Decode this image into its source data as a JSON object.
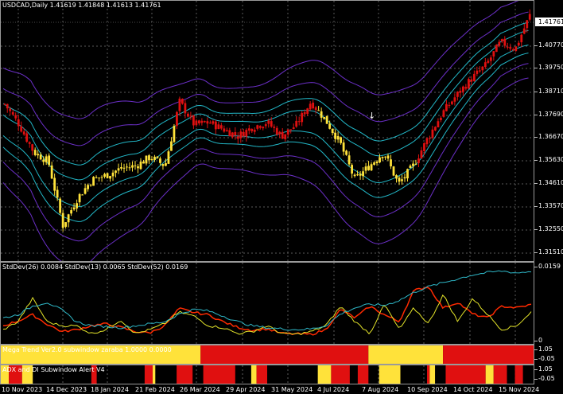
{
  "symbol_header": "USDCAD,Daily  1.41619 1.41848 1.41613 1.41761",
  "current_price": "1.41761",
  "price_axis": [
    "1.40770",
    "1.39750",
    "1.38710",
    "1.37690",
    "1.36670",
    "1.35630",
    "1.34610",
    "1.33570",
    "1.32550",
    "1.31510"
  ],
  "std_header": "StdDev(26) 0.0084  StdDev(13) 0.0065  StdDev(52) 0.0169",
  "std_axis": [
    "0.0159",
    "0"
  ],
  "mega_header": "Mega Trend Ver2.0 subwindow zaraba 1.0000 0.0000",
  "mega_axis": [
    "1.05",
    "-0.05"
  ],
  "adx_header": "ADX and DI Subwindow Alert V4",
  "adx_axis": [
    "1.05",
    "-0.05"
  ],
  "time_axis": [
    "10 Nov 2023",
    "14 Dec 2023",
    "18 Jan 2024",
    "21 Feb 2024",
    "26 Mar 2024",
    "29 Apr 2024",
    "31 May 2024",
    "4 Jul 2024",
    "7 Aug 2024",
    "10 Sep 2024",
    "14 Oct 2024",
    "15 Nov 2024"
  ],
  "colors": {
    "background": "#000000",
    "grid": "#5a5a5a",
    "bull_candle": "#ffe23a",
    "bear_candle": "#e01010",
    "band_inner": "#22b8c8",
    "band_outer": "#6b2fc8",
    "std26": "#ff2a00",
    "std13": "#e6e62a",
    "std52": "#2fb8c8",
    "mega_yellow": "#ffe23a",
    "mega_red": "#e01010"
  },
  "chart_data": [
    {
      "type": "candlestick",
      "title": "USDCAD,Daily",
      "ohlc_last": {
        "open": 1.41619,
        "high": 1.41848,
        "low": 1.41613,
        "close": 1.41761
      },
      "ylim": [
        1.3105,
        1.424
      ],
      "x": [
        "10 Nov 2023",
        "14 Dec 2023",
        "18 Jan 2024",
        "21 Feb 2024",
        "26 Mar 2024",
        "29 Apr 2024",
        "31 May 2024",
        "4 Jul 2024",
        "7 Aug 2024",
        "10 Sep 2024",
        "14 Oct 2024",
        "15 Nov 2024"
      ],
      "close_path": [
        1.379,
        1.37,
        1.358,
        1.354,
        1.326,
        1.338,
        1.346,
        1.348,
        1.351,
        1.352,
        1.356,
        1.352,
        1.38,
        1.37,
        1.371,
        1.368,
        1.365,
        1.369,
        1.371,
        1.365,
        1.37,
        1.38,
        1.372,
        1.362,
        1.346,
        1.352,
        1.358,
        1.344,
        1.352,
        1.364,
        1.375,
        1.383,
        1.39,
        1.396,
        1.406,
        1.403,
        1.4176
      ],
      "trend_state": [
        "bear",
        "bear",
        "bull",
        "bull",
        "bull",
        "bull",
        "bull",
        "bull",
        "bull",
        "bull",
        "bull",
        "bull",
        "bear",
        "bear",
        "bear",
        "bear",
        "bear",
        "bear",
        "bear",
        "bear",
        "bear",
        "bear",
        "bull",
        "bull",
        "bull",
        "bull",
        "bull",
        "bull",
        "bull",
        "bear",
        "bear",
        "bear",
        "bear",
        "bear",
        "bear",
        "bear",
        "bear"
      ],
      "series": [
        {
          "name": "inner band",
          "values_hint": "cyan envelope"
        },
        {
          "name": "outer band",
          "values_hint": "purple envelope"
        }
      ]
    },
    {
      "type": "line",
      "title": "StdDev",
      "ylim": [
        0,
        0.0175
      ],
      "series": [
        {
          "name": "StdDev(26)",
          "values": [
            0.003,
            0.0042,
            0.0058,
            0.0034,
            0.0015,
            0.002,
            0.003,
            0.0035,
            0.0026,
            0.0015,
            0.0012,
            0.003,
            0.0074,
            0.0064,
            0.0058,
            0.004,
            0.0026,
            0.0018,
            0.0022,
            0.001,
            0.0009,
            0.0008,
            0.002,
            0.0072,
            0.005,
            0.008,
            0.0058,
            0.004,
            0.012,
            0.013,
            0.0075,
            0.009,
            0.006,
            0.005,
            0.008,
            0.0076,
            0.0084
          ]
        },
        {
          "name": "StdDev(13)",
          "values": [
            0.002,
            0.004,
            0.01,
            0.004,
            0.003,
            0.003,
            0.001,
            0.002,
            0.0045,
            0.001,
            0.002,
            0.0035,
            0.0065,
            0.0055,
            0.003,
            0.0025,
            0.001,
            0.0015,
            0.003,
            0.001,
            0.0008,
            0.0015,
            0.003,
            0.008,
            0.004,
            0.001,
            0.0085,
            0.002,
            0.0075,
            0.0035,
            0.011,
            0.004,
            0.01,
            0.006,
            0.002,
            0.003,
            0.0065
          ]
        },
        {
          "name": "StdDev(52)",
          "values": [
            0.005,
            0.0058,
            0.008,
            0.009,
            0.007,
            0.004,
            0.003,
            0.0028,
            0.0025,
            0.003,
            0.0035,
            0.004,
            0.006,
            0.0072,
            0.0068,
            0.0055,
            0.004,
            0.003,
            0.0025,
            0.0022,
            0.002,
            0.0022,
            0.003,
            0.006,
            0.0076,
            0.0085,
            0.0082,
            0.0095,
            0.0115,
            0.013,
            0.014,
            0.015,
            0.016,
            0.0166,
            0.017,
            0.0165,
            0.0169
          ]
        }
      ]
    },
    {
      "type": "heatmap",
      "title": "Mega Trend Ver2.0",
      "segments": [
        {
          "state": "bull",
          "from": 0.0,
          "to": 0.375
        },
        {
          "state": "bear",
          "from": 0.375,
          "to": 0.69
        },
        {
          "state": "bull",
          "from": 0.69,
          "to": 0.83
        },
        {
          "state": "bear",
          "from": 0.83,
          "to": 1.0
        }
      ]
    },
    {
      "type": "heatmap",
      "title": "ADX and DI",
      "segments": [
        {
          "state": "bull",
          "from": 0.0,
          "to": 0.015
        },
        {
          "state": "bear",
          "from": 0.015,
          "to": 0.04
        },
        {
          "state": "bull",
          "from": 0.04,
          "to": 0.06
        },
        {
          "state": "bear",
          "from": 0.17,
          "to": 0.18
        },
        {
          "state": "bear",
          "from": 0.27,
          "to": 0.285
        },
        {
          "state": "bull",
          "from": 0.285,
          "to": 0.29
        },
        {
          "state": "bear",
          "from": 0.33,
          "to": 0.36
        },
        {
          "state": "bear",
          "from": 0.38,
          "to": 0.44
        },
        {
          "state": "bull",
          "from": 0.47,
          "to": 0.48
        },
        {
          "state": "bear",
          "from": 0.48,
          "to": 0.5
        },
        {
          "state": "bull",
          "from": 0.595,
          "to": 0.62
        },
        {
          "state": "bear",
          "from": 0.62,
          "to": 0.655
        },
        {
          "state": "bear",
          "from": 0.67,
          "to": 0.69
        },
        {
          "state": "bull",
          "from": 0.71,
          "to": 0.75
        },
        {
          "state": "bear",
          "from": 0.8,
          "to": 0.805
        },
        {
          "state": "bull",
          "from": 0.805,
          "to": 0.815
        },
        {
          "state": "bear",
          "from": 0.835,
          "to": 0.91
        },
        {
          "state": "bull",
          "from": 0.91,
          "to": 0.925
        },
        {
          "state": "bear",
          "from": 0.925,
          "to": 0.95
        },
        {
          "state": "bear",
          "from": 0.965,
          "to": 0.98
        }
      ]
    }
  ]
}
